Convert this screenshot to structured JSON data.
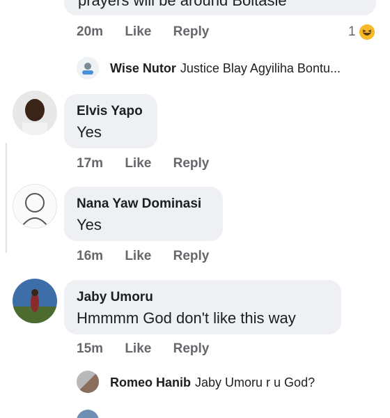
{
  "comment0": {
    "text_partial": "prayers will be around Boltasie",
    "time": "20m",
    "like": "Like",
    "reply": "Reply",
    "reaction_count": "1"
  },
  "reply_preview_1": {
    "name": "Wise Nutor",
    "text": "Justice Blay Agyiliha Bontu..."
  },
  "comment1": {
    "author": "Elvis Yapo",
    "text": "Yes",
    "time": "17m",
    "like": "Like",
    "reply": "Reply"
  },
  "comment2": {
    "author": "Nana Yaw Dominasi",
    "text": "Yes",
    "time": "16m",
    "like": "Like",
    "reply": "Reply"
  },
  "comment3": {
    "author": "Jaby Umoru",
    "text": "Hmmmm God don't like this way",
    "time": "15m",
    "like": "Like",
    "reply": "Reply"
  },
  "reply_preview_2": {
    "name": "Romeo Hanib",
    "text": "Jaby Umoru r u God?"
  },
  "colors": {
    "bubble": "#eef0f3",
    "meta": "#65676b",
    "text": "#1c1e21",
    "reaction": "#f7b928"
  }
}
